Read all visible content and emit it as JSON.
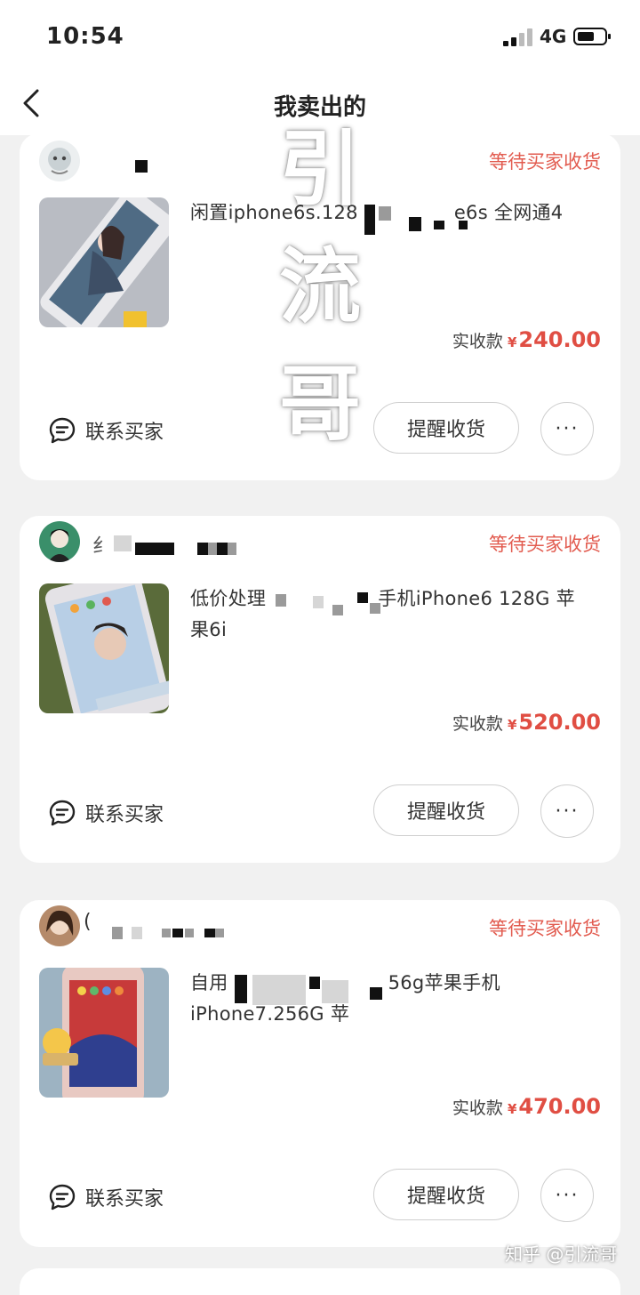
{
  "status_bar": {
    "time": "10:54",
    "network": "4G"
  },
  "nav": {
    "title": "我卖出的"
  },
  "orders": [
    {
      "buyer_initial": "",
      "status": "等待买家收货",
      "title_a": "闲置iphone6s.128",
      "title_b": "e6s 全网通4",
      "title_line2": "",
      "price_label": "实收款",
      "price": "240.00",
      "contact_label": "联系买家",
      "remind_label": "提醒收货",
      "more_label": "···"
    },
    {
      "buyer_initial": "纟",
      "status": "等待买家收货",
      "title_a": "低价处理",
      "title_b": "手机iPhone6 128G 苹",
      "title_line2": "果6i",
      "price_label": "实收款",
      "price": "520.00",
      "contact_label": "联系买家",
      "remind_label": "提醒收货",
      "more_label": "···"
    },
    {
      "buyer_initial": "(",
      "status": "等待买家收货",
      "title_a": "自用",
      "title_b": "56g苹果手机",
      "title_line2": "iPhone7.256G 苹",
      "price_label": "实收款",
      "price": "470.00",
      "contact_label": "联系买家",
      "remind_label": "提醒收货",
      "more_label": "···"
    }
  ],
  "watermark": {
    "chars": [
      "引",
      "流",
      "哥"
    ],
    "corner_text": "知乎 @引流哥"
  },
  "colors": {
    "accent_red": "#e25b4f",
    "price_red": "#e04e43"
  }
}
